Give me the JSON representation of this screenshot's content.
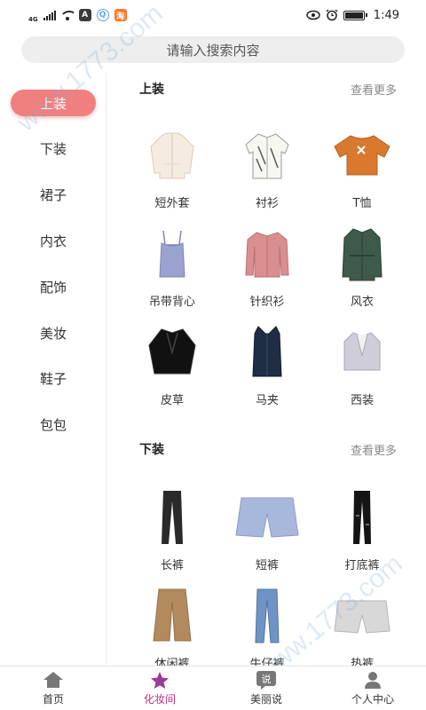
{
  "status_bar": {
    "network": "4G",
    "time": "1:49",
    "app_icons": [
      {
        "name": "alipay-icon",
        "color": "#3a3a3a",
        "glyph": "Ⓐ"
      },
      {
        "name": "qq-icon",
        "color": "#5aa7e6",
        "glyph": "Q"
      },
      {
        "name": "taobao-icon",
        "color": "#ff7a2a",
        "glyph": "淘"
      }
    ]
  },
  "search": {
    "placeholder": "请输入搜索内容"
  },
  "sidebar": {
    "items": [
      {
        "label": "上装",
        "active": true
      },
      {
        "label": "下装",
        "active": false
      },
      {
        "label": "裙子",
        "active": false
      },
      {
        "label": "内衣",
        "active": false
      },
      {
        "label": "配饰",
        "active": false
      },
      {
        "label": "美妆",
        "active": false
      },
      {
        "label": "鞋子",
        "active": false
      },
      {
        "label": "包包",
        "active": false
      }
    ]
  },
  "sections": [
    {
      "title": "上装",
      "more": "查看更多",
      "items": [
        {
          "label": "短外套",
          "icon": "short-jacket-icon"
        },
        {
          "label": "衬衫",
          "icon": "shirt-icon"
        },
        {
          "label": "T恤",
          "icon": "tshirt-icon"
        },
        {
          "label": "吊带背心",
          "icon": "camisole-icon"
        },
        {
          "label": "针织衫",
          "icon": "knit-sweater-icon"
        },
        {
          "label": "风衣",
          "icon": "trench-coat-icon"
        },
        {
          "label": "皮草",
          "icon": "fur-coat-icon"
        },
        {
          "label": "马夹",
          "icon": "vest-icon"
        },
        {
          "label": "西装",
          "icon": "blazer-icon"
        }
      ]
    },
    {
      "title": "下装",
      "more": "查看更多",
      "items": [
        {
          "label": "长裤",
          "icon": "trousers-icon"
        },
        {
          "label": "短裤",
          "icon": "shorts-icon"
        },
        {
          "label": "打底裤",
          "icon": "leggings-icon"
        },
        {
          "label": "休闲裤",
          "icon": "casual-pants-icon"
        },
        {
          "label": "牛仔裤",
          "icon": "jeans-icon"
        },
        {
          "label": "热裤",
          "icon": "hot-pants-icon"
        }
      ]
    }
  ],
  "tabbar": {
    "items": [
      {
        "label": "首页",
        "icon": "home-icon",
        "active": false
      },
      {
        "label": "化妆间",
        "icon": "star-icon",
        "active": true
      },
      {
        "label": "美丽说",
        "icon": "say-icon",
        "active": false
      },
      {
        "label": "个人中心",
        "icon": "person-icon",
        "active": false
      }
    ]
  },
  "watermark": "www.1773.com",
  "colors": {
    "accent": "#f08080",
    "tab_active": "#c0307a",
    "more_text": "#888888"
  }
}
